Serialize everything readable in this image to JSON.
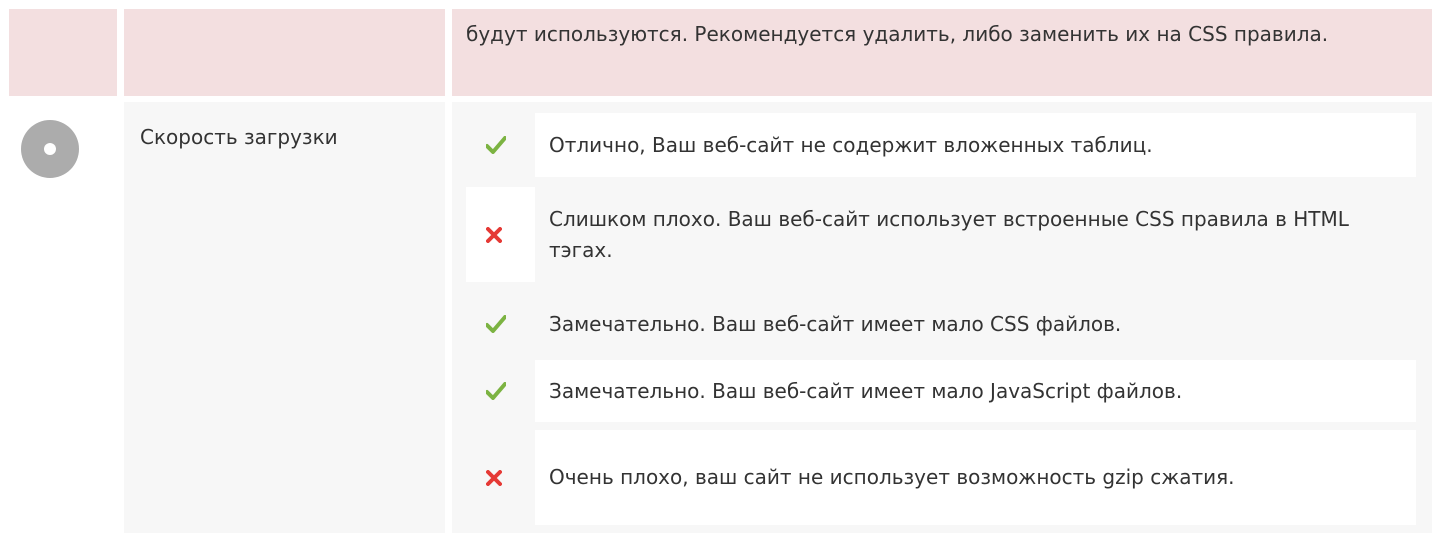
{
  "colors": {
    "alert_bg": "#f3dfe0",
    "cell_bg": "#f7f7f7",
    "ok_green": "#7cb342",
    "fail_red": "#e53935",
    "neutral_grey": "#acacac"
  },
  "top": {
    "text": "будут используются. Рекомендуется удалить, либо заменить их на CSS правила."
  },
  "section": {
    "label": "Скорость загрузки",
    "status_icon": "neutral-circle-icon"
  },
  "checks": [
    {
      "status": "ok",
      "icon": "check-icon",
      "text": "Отлично, Ваш веб-сайт не содержит вложенных таблиц."
    },
    {
      "status": "fail",
      "icon": "cross-icon",
      "text": "Слишком плохо. Ваш веб-сайт использует встроенные CSS правила в HTML тэгах."
    },
    {
      "status": "ok",
      "icon": "check-icon",
      "text": "Замечательно. Ваш веб-сайт имеет мало CSS файлов."
    },
    {
      "status": "ok",
      "icon": "check-icon",
      "text": "Замечательно. Ваш веб-сайт имеет мало JavaScript файлов."
    },
    {
      "status": "fail",
      "icon": "cross-icon",
      "text": "Очень плохо, ваш сайт не использует возможность gzip сжатия."
    }
  ]
}
